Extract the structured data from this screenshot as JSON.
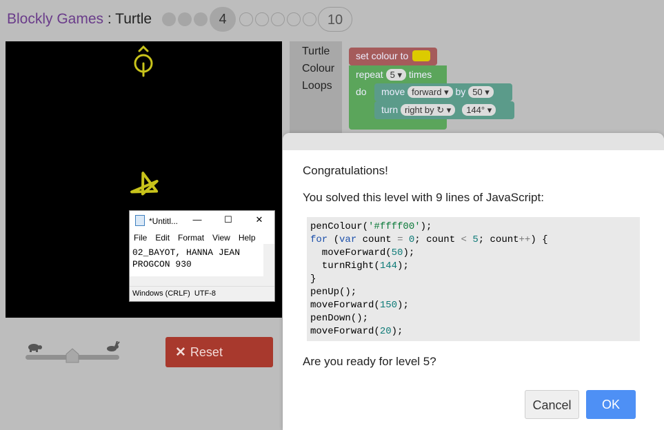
{
  "header": {
    "brand": "Blockly Games",
    "separator": " : ",
    "game": "Turtle",
    "current_level": "4",
    "last_level": "10"
  },
  "notepad": {
    "title": "*Untitl...",
    "menu": [
      "File",
      "Edit",
      "Format",
      "View",
      "Help"
    ],
    "lines": [
      "02_BAYOT, HANNA JEAN",
      "PROGCON 930"
    ],
    "status": "Windows (CRLF)",
    "encoding": "UTF-8"
  },
  "controls": {
    "reset_label": "Reset"
  },
  "toolbox": {
    "categories": [
      "Turtle",
      "Colour",
      "Loops"
    ]
  },
  "blocks": {
    "set_colour": "set colour to",
    "repeat": "repeat",
    "repeat_count": "5",
    "times": "times",
    "do": "do",
    "move": "move",
    "move_dir": "forward",
    "by": "by",
    "move_amount": "50",
    "turn": "turn",
    "turn_dir": "right by ↻",
    "turn_angle": "144°"
  },
  "dialog": {
    "heading": "Congratulations!",
    "summary": "You solved this level with 9 lines of JavaScript:",
    "code": [
      "penColour('#ffff00');",
      "for (var count = 0; count < 5; count++) {",
      "  moveForward(50);",
      "  turnRight(144);",
      "}",
      "penUp();",
      "moveForward(150);",
      "penDown();",
      "moveForward(20);"
    ],
    "question": "Are you ready for level 5?",
    "cancel_label": "Cancel",
    "ok_label": "OK"
  },
  "colors": {
    "pen": "#ffff00",
    "reset": "#a8392d",
    "ok": "#4e90f5",
    "colour_block": "#a55b5b",
    "loop_block": "#5ba55b",
    "turtle_block": "#5b9b8a"
  }
}
